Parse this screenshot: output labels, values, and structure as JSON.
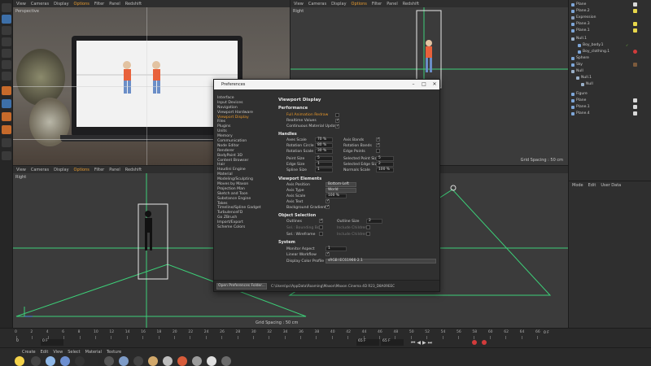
{
  "viewports": {
    "perspective": {
      "label": "Perspective",
      "menu": [
        "View",
        "Cameras",
        "Display",
        "Options",
        "Filter",
        "Panel",
        "Redshift"
      ]
    },
    "right_top": {
      "label": "Right",
      "menu": [
        "View",
        "Cameras",
        "Display",
        "Options",
        "Filter",
        "Panel",
        "Redshift"
      ],
      "grid_spacing": "Grid Spacing : 50 cm"
    },
    "right_bottom": {
      "label": "Right",
      "menu": [
        "View",
        "Cameras",
        "Display",
        "Options",
        "Filter",
        "Panel",
        "Redshift"
      ],
      "grid_spacing": "Grid Spacing : 50 cm"
    }
  },
  "object_manager": {
    "items": [
      "Plane",
      "Plane.2",
      "Expression",
      "Plane.3",
      "Plane.1",
      "Null.1",
      "Boy_body.1",
      "Boy_clothing.1",
      "Sphere",
      "Sky",
      "Null",
      "Null.1",
      "Null",
      "Figure",
      "Plane",
      "Plane.1",
      "Plane.4"
    ]
  },
  "attributes": {
    "menu": [
      "Mode",
      "Edit",
      "User Data"
    ]
  },
  "preferences": {
    "title": "Preferences",
    "nav": [
      "Interface",
      "Input Devices",
      "Navigation",
      "Viewport Hardware",
      "Viewport Display",
      "Files",
      "Plugins",
      "Units",
      "Memory",
      "Communication",
      "Node Editor",
      "Renderer",
      "BodyPaint 3D",
      "Content Browser",
      "Hair",
      "Houdini Engine",
      "Material",
      "Modeling/Sculpting",
      "Moves by Maxon",
      "Projection Man",
      "Sketch and Toon",
      "Substance Engine",
      "Takes",
      "Timeline/Spline Gadget",
      "TurbulenceFD",
      "Go ZBrush",
      "Import/Export",
      "Scheme Colors"
    ],
    "selected_nav": "Viewport Display",
    "heading": "Viewport Display",
    "performance": {
      "title": "Performance",
      "full_animation_redraw": "Full Animation Redraw",
      "realtime_values": "Realtime Values",
      "continuous_material_update": "Continuous Material Update"
    },
    "handles": {
      "title": "Handles",
      "axes_scale": "Axes Scale",
      "axes_scale_val": "70 %",
      "rotation_circle": "Rotation Circle",
      "rotation_circle_val": "80 %",
      "rotation_scale": "Rotation Scale",
      "rotation_scale_val": "30 %",
      "point_size": "Point Size",
      "point_size_val": "5",
      "edge_size": "Edge Size",
      "edge_size_val": "1",
      "spline_size": "Spline Size",
      "spline_size_val": "1",
      "axis_bands": "Axis Bands",
      "rotation_bands": "Rotation Bands",
      "edge_points": "Edge Points",
      "selected_point_size": "Selected Point Size",
      "selected_point_size_val": "5",
      "selected_edge_size": "Selected Edge Size",
      "selected_edge_size_val": "2",
      "normals_scale": "Normals Scale",
      "normals_scale_val": "100 %"
    },
    "viewport_elements": {
      "title": "Viewport Elements",
      "axis_position": "Axis Position",
      "axis_position_val": "Bottom-Left",
      "axis_type": "Axis Type",
      "axis_type_val": "World",
      "axis_scale": "Axis Scale",
      "axis_scale_val": "100 %",
      "axis_text": "Axis Text",
      "background_gradient": "Background Gradient"
    },
    "object_selection": {
      "title": "Object Selection",
      "outlines": "Outlines",
      "outline_size": "Outline Size",
      "outline_size_val": "2",
      "sel_bounding_box": "Sel.: Bounding Box",
      "include_children_1": "Include Children",
      "sel_wireframe": "Sel.: Wireframe",
      "include_children_2": "Include Children"
    },
    "system": {
      "title": "System",
      "monitor_aspect": "Monitor Aspect",
      "monitor_aspect_val": "1",
      "linear_workflow": "Linear Workflow",
      "display_color_profile": "Display Color Profile",
      "display_color_profile_val": "sRGB IEC61966-2.1"
    },
    "open_folder_button": "Open Preferences Folder...",
    "path": "C:\\Users\\pc\\AppData\\Roaming\\Maxon\\Maxon Cinema 4D R23_D8A09EEC"
  },
  "timeline": {
    "ticks": [
      "0",
      "2",
      "4",
      "6",
      "8",
      "10",
      "12",
      "14",
      "16",
      "18",
      "20",
      "22",
      "24",
      "26",
      "28",
      "30",
      "32",
      "34",
      "36",
      "38",
      "40",
      "42",
      "44",
      "46",
      "48",
      "50",
      "52",
      "54",
      "56",
      "58",
      "60",
      "62",
      "64",
      "66"
    ],
    "current_frame": "0 F",
    "start": "0",
    "start_field": "0 F",
    "end_field": "65 F",
    "end_field_2": "65 F"
  },
  "material_bar": {
    "menu": [
      "Create",
      "Edit",
      "View",
      "Select",
      "Material",
      "Texture"
    ]
  },
  "colors": {
    "accent": "#e6962a",
    "selection_green": "#3ccf78",
    "outline_white": "#e8e8e8"
  }
}
